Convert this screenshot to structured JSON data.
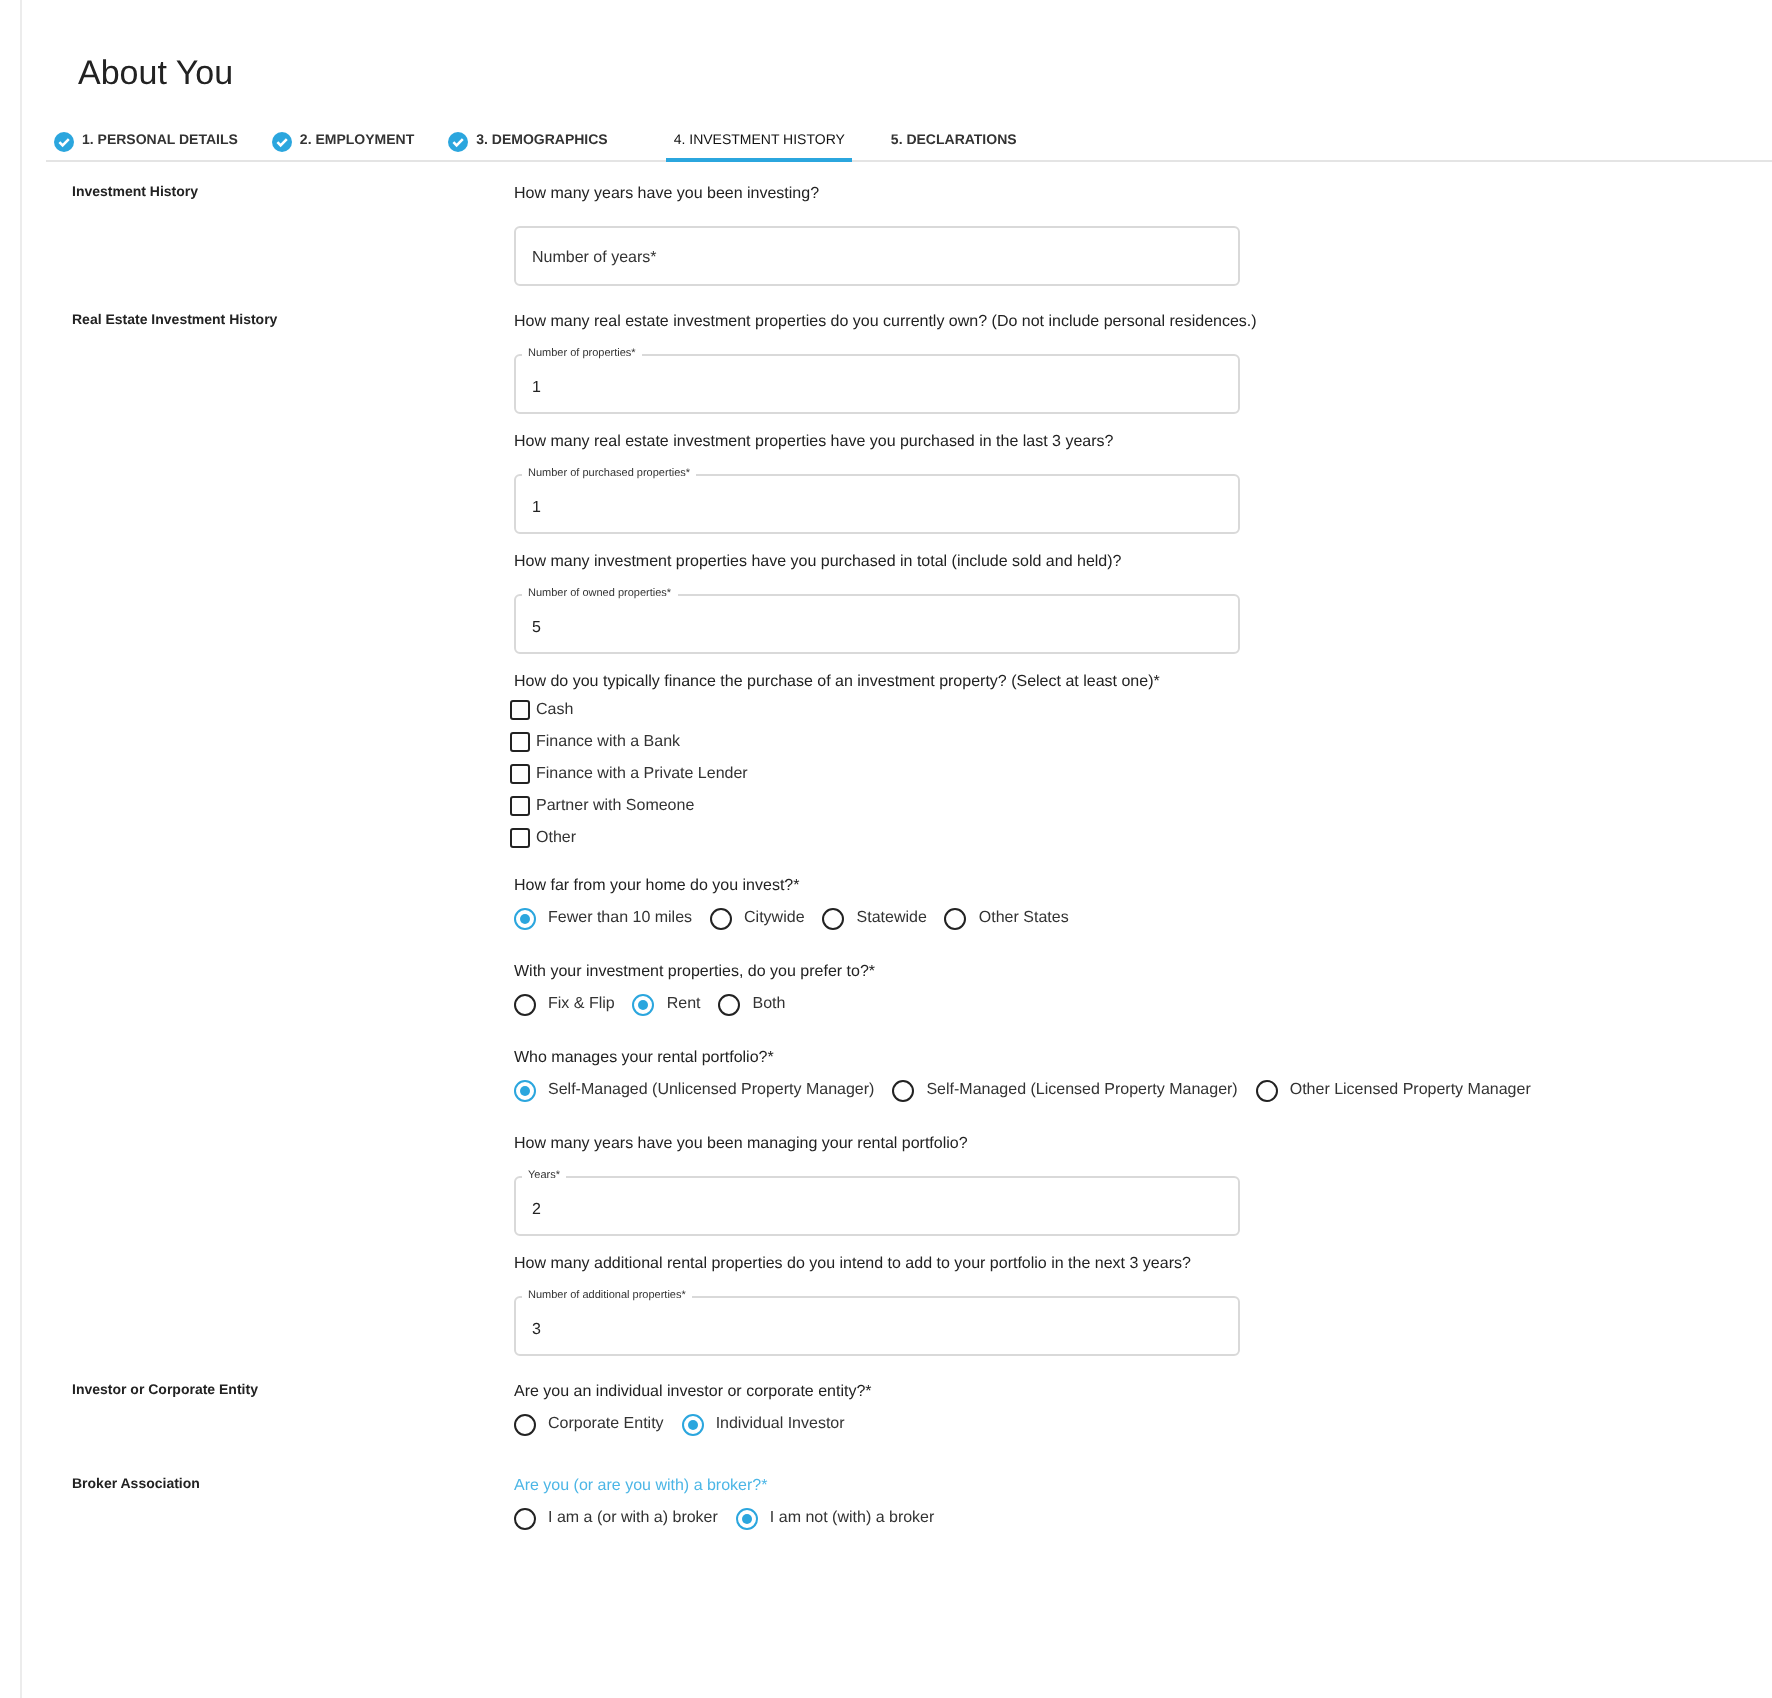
{
  "page": {
    "title": "About You"
  },
  "tabs": [
    {
      "label": "1. PERSONAL DETAILS",
      "completed": true,
      "selected": false
    },
    {
      "label": "2. EMPLOYMENT",
      "completed": true,
      "selected": false
    },
    {
      "label": "3. DEMOGRAPHICS",
      "completed": true,
      "selected": false
    },
    {
      "label": "4. INVESTMENT HISTORY",
      "completed": false,
      "selected": true
    },
    {
      "label": "5. DECLARATIONS",
      "completed": false,
      "selected": false
    }
  ],
  "sections": [
    {
      "label": "Investment History",
      "questions": [
        {
          "kind": "number",
          "prompt": "How many years have you been investing?",
          "focused": false,
          "placeholder": "Number of years*"
        }
      ]
    },
    {
      "label": "Real Estate Investment History",
      "questions": [
        {
          "kind": "number",
          "prompt": "How many real estate investment properties do you currently own? (Do not include personal residences.)",
          "focused": false,
          "field_label": "Number of properties*",
          "value": "1"
        },
        {
          "kind": "number",
          "prompt": "How many real estate investment properties have you purchased in the last 3 years?",
          "focused": false,
          "field_label": "Number of purchased properties*",
          "value": "1"
        },
        {
          "kind": "number",
          "prompt": "How many investment properties have you purchased in total (include sold and held)?",
          "focused": false,
          "field_label": "Number of owned properties*",
          "value": "5"
        },
        {
          "kind": "checkboxes",
          "prompt": "How do you typically finance the purchase of an investment property? (Select at least one)*",
          "focused": false,
          "options": [
            {
              "label": "Cash",
              "checked": false
            },
            {
              "label": "Finance with a Bank",
              "checked": false
            },
            {
              "label": "Finance with a Private Lender",
              "checked": false
            },
            {
              "label": "Partner with Someone",
              "checked": false
            },
            {
              "label": "Other",
              "checked": false
            }
          ]
        },
        {
          "kind": "radios",
          "prompt": "How far from your home do you invest?*",
          "focused": false,
          "options": [
            {
              "label": "Fewer than 10 miles",
              "selected": true
            },
            {
              "label": "Citywide",
              "selected": false
            },
            {
              "label": "Statewide",
              "selected": false
            },
            {
              "label": "Other States",
              "selected": false
            }
          ]
        },
        {
          "kind": "radios",
          "prompt": "With your investment properties, do you prefer to?*",
          "focused": false,
          "options": [
            {
              "label": "Fix & Flip",
              "selected": false
            },
            {
              "label": "Rent",
              "selected": true
            },
            {
              "label": "Both",
              "selected": false
            }
          ]
        },
        {
          "kind": "radios",
          "prompt": "Who manages your rental portfolio?*",
          "focused": false,
          "options": [
            {
              "label": "Self-Managed (Unlicensed Property Manager)",
              "selected": true
            },
            {
              "label": "Self-Managed (Licensed Property Manager)",
              "selected": false
            },
            {
              "label": "Other Licensed Property Manager",
              "selected": false
            }
          ]
        },
        {
          "kind": "number",
          "prompt": "How many years have you been managing your rental portfolio?",
          "focused": false,
          "field_label": "Years*",
          "value": "2"
        },
        {
          "kind": "number",
          "prompt": "How many additional rental properties do you intend to add to your portfolio in the next 3 years?",
          "focused": false,
          "field_label": "Number of additional properties*",
          "value": "3"
        }
      ]
    },
    {
      "label": "Investor or Corporate Entity",
      "questions": [
        {
          "kind": "radios",
          "prompt": "Are you an individual investor or corporate entity?*",
          "focused": false,
          "options": [
            {
              "label": "Corporate Entity",
              "selected": false
            },
            {
              "label": "Individual Investor",
              "selected": true
            }
          ]
        }
      ]
    },
    {
      "label": "Broker Association",
      "questions": [
        {
          "kind": "radios",
          "prompt": "Are you (or are you with) a broker?*",
          "focused": true,
          "options": [
            {
              "label": "I am a (or with a) broker",
              "selected": false
            },
            {
              "label": "I am not (with) a broker",
              "selected": true
            }
          ]
        }
      ]
    }
  ]
}
